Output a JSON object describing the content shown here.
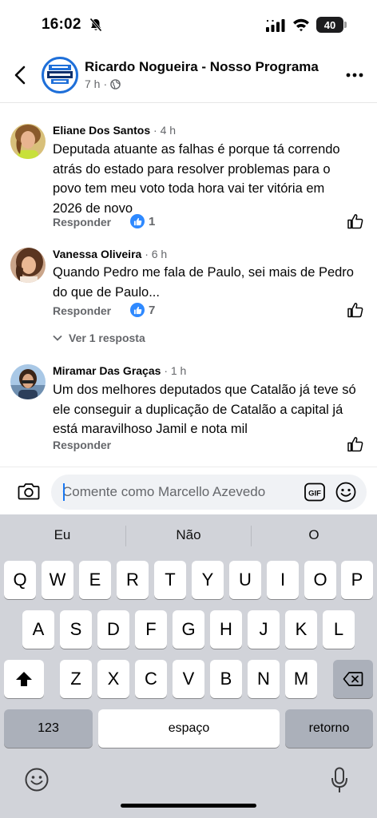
{
  "status": {
    "time": "16:02",
    "battery": "40"
  },
  "header": {
    "page_name": "Ricardo Nogueira - Nosso Programa",
    "posted_ago": "7 h"
  },
  "comments": [
    {
      "author": "Eliane Dos Santos",
      "time": "· 4 h",
      "lines": [
        "Deputada atuante as falhas é porque tá correndo",
        "atrás do estado para resolver problemas para o",
        "povo tem meu voto toda hora vai ter vitória em",
        "2026 de novo"
      ],
      "reply_label": "Responder",
      "reactions": "1"
    },
    {
      "author": "Vanessa Oliveira",
      "time": "· 6 h",
      "lines": [
        "Quando Pedro me fala de Paulo, sei mais de Pedro",
        "do que de Paulo..."
      ],
      "reply_label": "Responder",
      "reactions": "7",
      "view_replies": "Ver 1 resposta"
    },
    {
      "author": "Miramar Das Graças",
      "time": "· 1 h",
      "lines": [
        "Um dos melhores deputados que Catalão já teve só",
        "ele conseguir a duplicação de Catalão a capital já",
        "está maravilhoso Jamil e nota mil"
      ],
      "reply_label": "Responder"
    }
  ],
  "composer": {
    "placeholder": "Comente como Marcello Azevedo"
  },
  "keyboard": {
    "suggestions": [
      "Eu",
      "Não",
      "O"
    ],
    "row1": [
      "Q",
      "W",
      "E",
      "R",
      "T",
      "Y",
      "U",
      "I",
      "O",
      "P"
    ],
    "row2": [
      "A",
      "S",
      "D",
      "F",
      "G",
      "H",
      "J",
      "K",
      "L"
    ],
    "row3": [
      "Z",
      "X",
      "C",
      "V",
      "B",
      "N",
      "M"
    ],
    "numbers_label": "123",
    "space_label": "espaço",
    "return_label": "retorno"
  },
  "colors": {
    "accent": "#1877f2",
    "like_blue": "#2e89ff",
    "keyboard_bg": "#d1d3d9"
  }
}
